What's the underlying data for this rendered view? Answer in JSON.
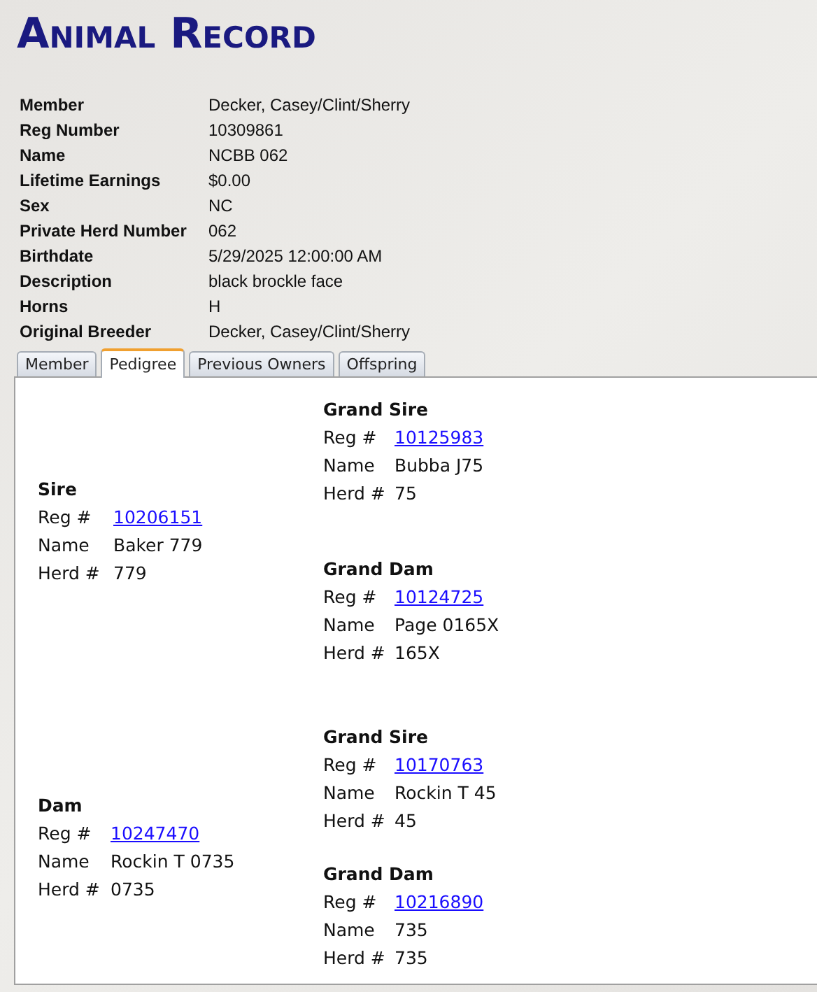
{
  "title": "Animal Record",
  "details": [
    {
      "label": "Member",
      "value": "Decker, Casey/Clint/Sherry"
    },
    {
      "label": "Reg Number",
      "value": "10309861"
    },
    {
      "label": "Name",
      "value": "NCBB 062"
    },
    {
      "label": "Lifetime Earnings",
      "value": "$0.00"
    },
    {
      "label": "Sex",
      "value": "NC"
    },
    {
      "label": "Private Herd Number",
      "value": "062"
    },
    {
      "label": "Birthdate",
      "value": "5/29/2025 12:00:00 AM"
    },
    {
      "label": "Description",
      "value": "black brockle face"
    },
    {
      "label": "Horns",
      "value": "H"
    },
    {
      "label": "Original Breeder",
      "value": "Decker, Casey/Clint/Sherry"
    }
  ],
  "tabs": [
    {
      "label": "Member",
      "selected": false
    },
    {
      "label": "Pedigree",
      "selected": true
    },
    {
      "label": "Previous Owners",
      "selected": false
    },
    {
      "label": "Offspring",
      "selected": false
    }
  ],
  "pedigree": [
    {
      "parent": {
        "title": "Sire",
        "reg_label": "Reg #",
        "reg": "10206151",
        "name_label": "Name",
        "name": "Baker 779",
        "herd_label": "Herd #",
        "herd": "779"
      },
      "grandparents": [
        {
          "title": "Grand Sire",
          "reg_label": "Reg #",
          "reg": "10125983",
          "name_label": "Name",
          "name": "Bubba J75",
          "herd_label": "Herd #",
          "herd": "75"
        },
        {
          "title": "Grand Dam",
          "reg_label": "Reg #",
          "reg": "10124725",
          "name_label": "Name",
          "name": "Page 0165X",
          "herd_label": "Herd #",
          "herd": "165X"
        }
      ]
    },
    {
      "parent": {
        "title": "Dam",
        "reg_label": "Reg #",
        "reg": "10247470",
        "name_label": "Name",
        "name": "Rockin T 0735",
        "herd_label": "Herd #",
        "herd": "0735"
      },
      "grandparents": [
        {
          "title": "Grand Sire",
          "reg_label": "Reg #",
          "reg": "10170763",
          "name_label": "Name",
          "name": "Rockin T 45",
          "herd_label": "Herd #",
          "herd": "45"
        },
        {
          "title": "Grand Dam",
          "reg_label": "Reg #",
          "reg": "10216890",
          "name_label": "Name",
          "name": "735",
          "herd_label": "Herd #",
          "herd": "735"
        }
      ]
    }
  ]
}
